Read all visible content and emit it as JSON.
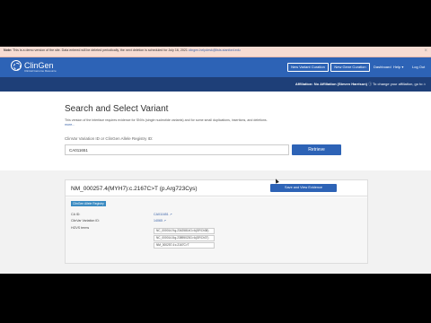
{
  "notice": {
    "prefix": "Note:",
    "text": "This is a demo version of the site. Data entered will be deleted periodically, the next deletion is scheduled for July 16, 2021",
    "link": "clingen-helpdesk@lists.stanford.edu",
    "close_symbol": "×"
  },
  "nav": {
    "logo_text": "ClinGen",
    "logo_sub": "Clinical Genome Resource",
    "new_variant": "New Variant Curation",
    "new_gene": "New Gene Curation",
    "dashboard": "Dashboard",
    "help": "Help",
    "logout": "Log Out"
  },
  "affiliation": {
    "label": "Affiliation:",
    "value": "No Affiliation (Steven Harrison)",
    "change": "To change your affiliation, go to"
  },
  "search": {
    "title": "Search and Select Variant",
    "description": "This version of the interface requires evidence for SNVs (single nucleotide variants) and for some small duplications, insertions, and deletions.",
    "more": "more...",
    "field_label": "ClinVar Variation ID or ClinGen Allele Registry ID:",
    "input_value": "CA011651",
    "retrieve": "Retrieve"
  },
  "variant": {
    "title": "NM_000257.4(MYH7):c.2167C>T (p.Arg723Cys)",
    "save_button": "Save and View Evidence",
    "badge": "ClinGen Allele Registry",
    "ca_label": "CA ID:",
    "ca_value": "CA011651",
    "clinvar_label": "ClinVar Variation ID:",
    "clinvar_value": "14065",
    "hgvs_label": "HGVS terms",
    "hgvs": [
      "NC_000014.9:g.23425814G>A(GRCh38)",
      "NC_000014.8:g.23895023G>A(GRCh37)",
      "NM_000257.4:c.2167C>T"
    ]
  }
}
